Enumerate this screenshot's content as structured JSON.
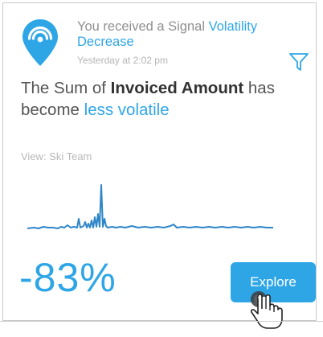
{
  "signal": {
    "prefix": "You received a Signal ",
    "type_line1": "Volatility",
    "type_line2": "Decrease",
    "timestamp": "Yesterday at 2:02 pm"
  },
  "headline": {
    "text1": "The Sum of ",
    "measure": "Invoiced Amount",
    "text2": " has",
    "text3": "become ",
    "change": "less volatile"
  },
  "view": {
    "label": "View: Ski Team"
  },
  "metric": {
    "percent": "-83%"
  },
  "actions": {
    "explore_label": "Explore"
  },
  "icons": {
    "pin": "location-pin-icon",
    "filter": "filter-icon",
    "cursor": "hand-pointer-icon"
  },
  "colors": {
    "accent": "#2ea6e6",
    "text": "#555555",
    "muted": "#8f8f8f"
  }
}
